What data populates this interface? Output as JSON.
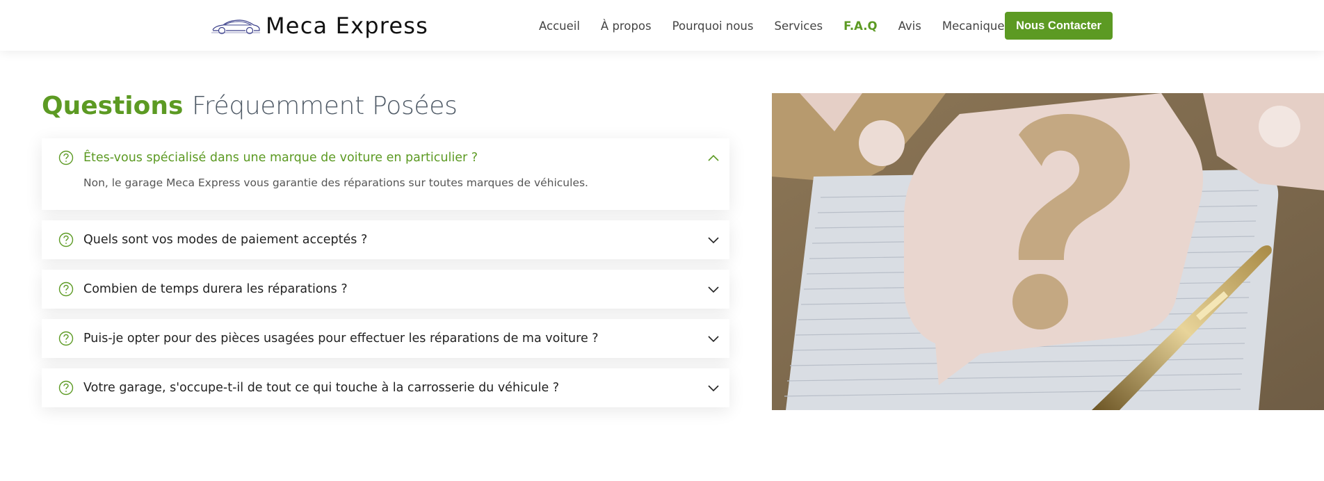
{
  "header": {
    "brand": "Meca Express",
    "logo_icon": "car-outline-icon",
    "nav": [
      {
        "label": "Accueil",
        "active": false
      },
      {
        "label": "À propos",
        "active": false
      },
      {
        "label": "Pourquoi nous",
        "active": false
      },
      {
        "label": "Services",
        "active": false
      },
      {
        "label": "F.A.Q",
        "active": true
      },
      {
        "label": "Avis",
        "active": false
      },
      {
        "label": "Mecanique",
        "active": false,
        "dropdown": true
      }
    ],
    "cta_label": "Nous Contacter"
  },
  "faq": {
    "title_strong": "Questions",
    "title_light": "Fréquemment Posées",
    "items": [
      {
        "question": "Êtes-vous spécialisé dans une marque de voiture en particulier ?",
        "answer": "Non, le garage Meca Express vous garantie des réparations sur toutes marques de véhicules.",
        "open": true
      },
      {
        "question": "Quels sont vos modes de paiement acceptés ?",
        "open": false
      },
      {
        "question": "Combien de temps durera les réparations ?",
        "open": false
      },
      {
        "question": "Puis-je opter pour des pièces usagées pour effectuer les réparations de ma voiture ?",
        "open": false
      },
      {
        "question": "Votre garage, s'occupe-t-il de tout ce qui touche à la carrosserie du véhicule ?",
        "open": false
      }
    ]
  },
  "colors": {
    "accent": "#5c9a23",
    "text": "#444444",
    "title_light": "#4f5a66"
  }
}
